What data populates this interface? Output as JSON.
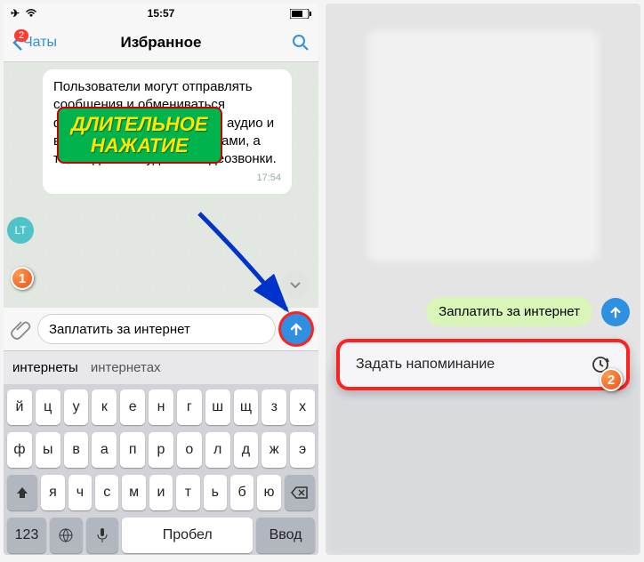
{
  "status": {
    "time": "15:57"
  },
  "nav": {
    "back_label": "Чаты",
    "badge": "2",
    "title": "Избранное"
  },
  "message": {
    "text": "Пользователи могут отправлять сообщения и обмениваться фотографиями, стикерами, аудио и видео сообщениями, файлами, а также делать аудио- и видеозвонки.",
    "time": "17:54",
    "avatar": "LT"
  },
  "callout": {
    "line1": "ДЛИТЕЛЬНОЕ",
    "line2": "НАЖАТИЕ"
  },
  "input": {
    "value": "Заплатить за интернет"
  },
  "suggestions": {
    "s1": "интернеты",
    "s2": "интернетах"
  },
  "keyboard": {
    "row1": [
      "й",
      "ц",
      "у",
      "к",
      "е",
      "н",
      "г",
      "ш",
      "щ",
      "з",
      "х"
    ],
    "row2": [
      "ф",
      "ы",
      "в",
      "а",
      "п",
      "р",
      "о",
      "л",
      "д",
      "ж",
      "э"
    ],
    "row3": [
      "я",
      "ч",
      "с",
      "м",
      "и",
      "т",
      "ь",
      "б",
      "ю"
    ],
    "bottom": {
      "nums": "123",
      "space": "Пробел",
      "enter": "Ввод"
    }
  },
  "right": {
    "chip": "Заплатить за интернет",
    "reminder": "Задать напоминание"
  },
  "badges": {
    "one": "1",
    "two": "2"
  }
}
